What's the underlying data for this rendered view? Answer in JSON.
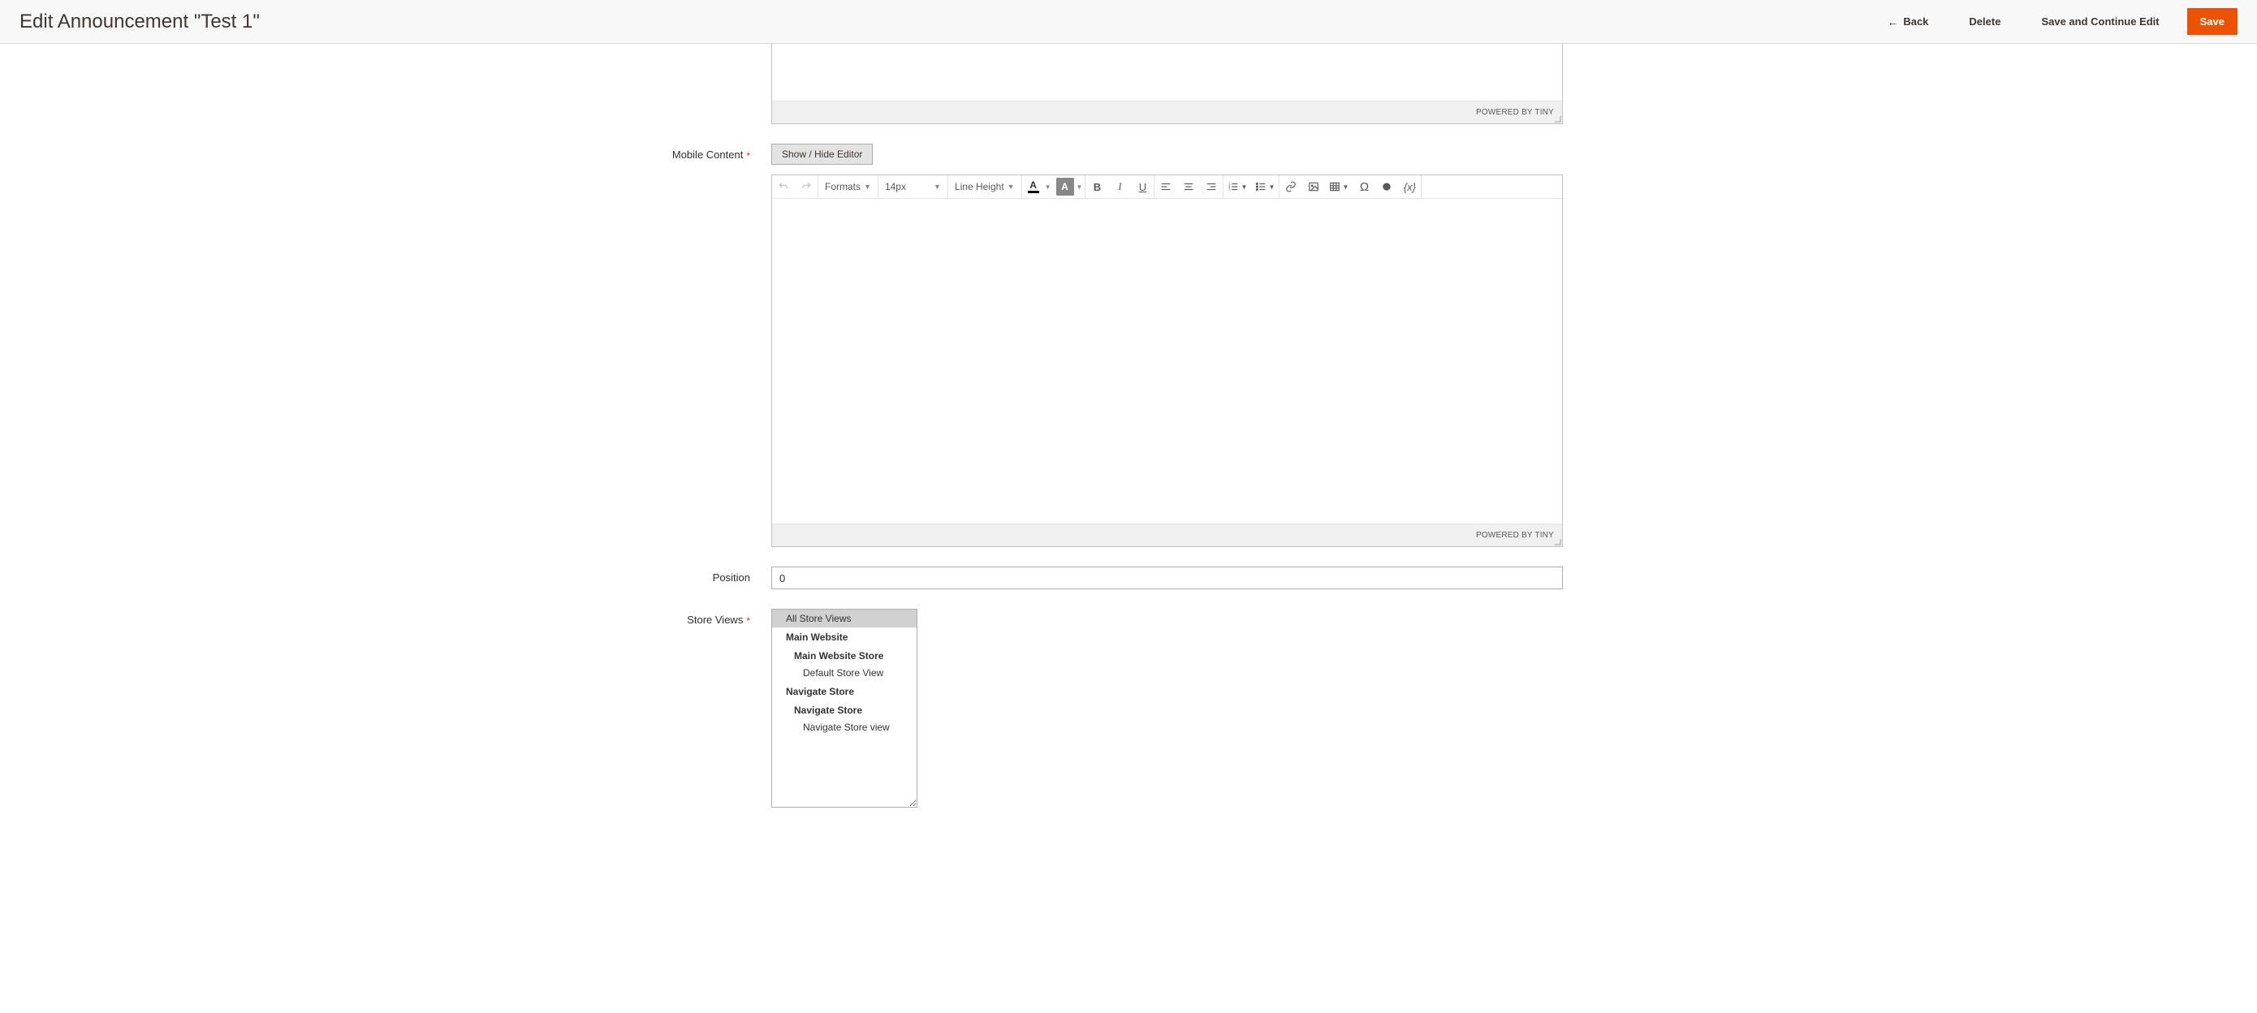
{
  "header": {
    "title": "Edit Announcement \"Test 1\"",
    "actions": {
      "back": "Back",
      "delete": "Delete",
      "save_continue": "Save and Continue Edit",
      "save": "Save"
    }
  },
  "editor": {
    "powered": "POWERED BY TINY",
    "toolbar": {
      "formats": "Formats",
      "fontsize": "14px",
      "lineheight": "Line Height"
    }
  },
  "fields": {
    "mobile_content": {
      "label": "Mobile Content",
      "show_hide": "Show / Hide Editor"
    },
    "position": {
      "label": "Position",
      "value": "0"
    },
    "store_views": {
      "label": "Store Views",
      "options": [
        {
          "label": "All Store Views",
          "level": "top",
          "selected": true
        },
        {
          "label": "Main Website",
          "level": "website",
          "selected": false
        },
        {
          "label": "Main Website Store",
          "level": "group",
          "selected": false
        },
        {
          "label": "Default Store View",
          "level": "view",
          "selected": false
        },
        {
          "label": "Navigate Store",
          "level": "website",
          "selected": false
        },
        {
          "label": "Navigate Store",
          "level": "group",
          "selected": false
        },
        {
          "label": "Navigate Store view",
          "level": "view",
          "selected": false
        }
      ]
    }
  }
}
